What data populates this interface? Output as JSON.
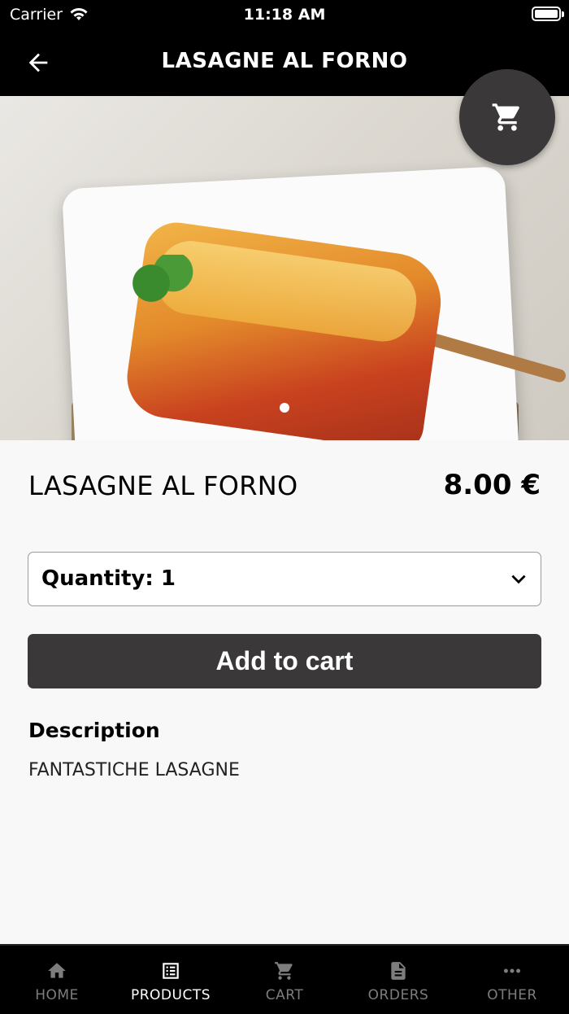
{
  "status_bar": {
    "carrier": "Carrier",
    "time": "11:18 AM"
  },
  "nav": {
    "title": "LASAGNE AL FORNO"
  },
  "product": {
    "name": "LASAGNE AL FORNO",
    "price": "8.00 €",
    "quantity_label": "Quantity: 1",
    "add_to_cart": "Add to cart",
    "description_title": "Description",
    "description": "FANTASTICHE LASAGNE"
  },
  "tabs": [
    {
      "label": "HOME",
      "icon": "home-icon",
      "active": false
    },
    {
      "label": "PRODUCTS",
      "icon": "list-icon",
      "active": true
    },
    {
      "label": "CART",
      "icon": "cart-icon",
      "active": false
    },
    {
      "label": "ORDERS",
      "icon": "document-icon",
      "active": false
    },
    {
      "label": "OTHER",
      "icon": "more-icon",
      "active": false
    }
  ]
}
